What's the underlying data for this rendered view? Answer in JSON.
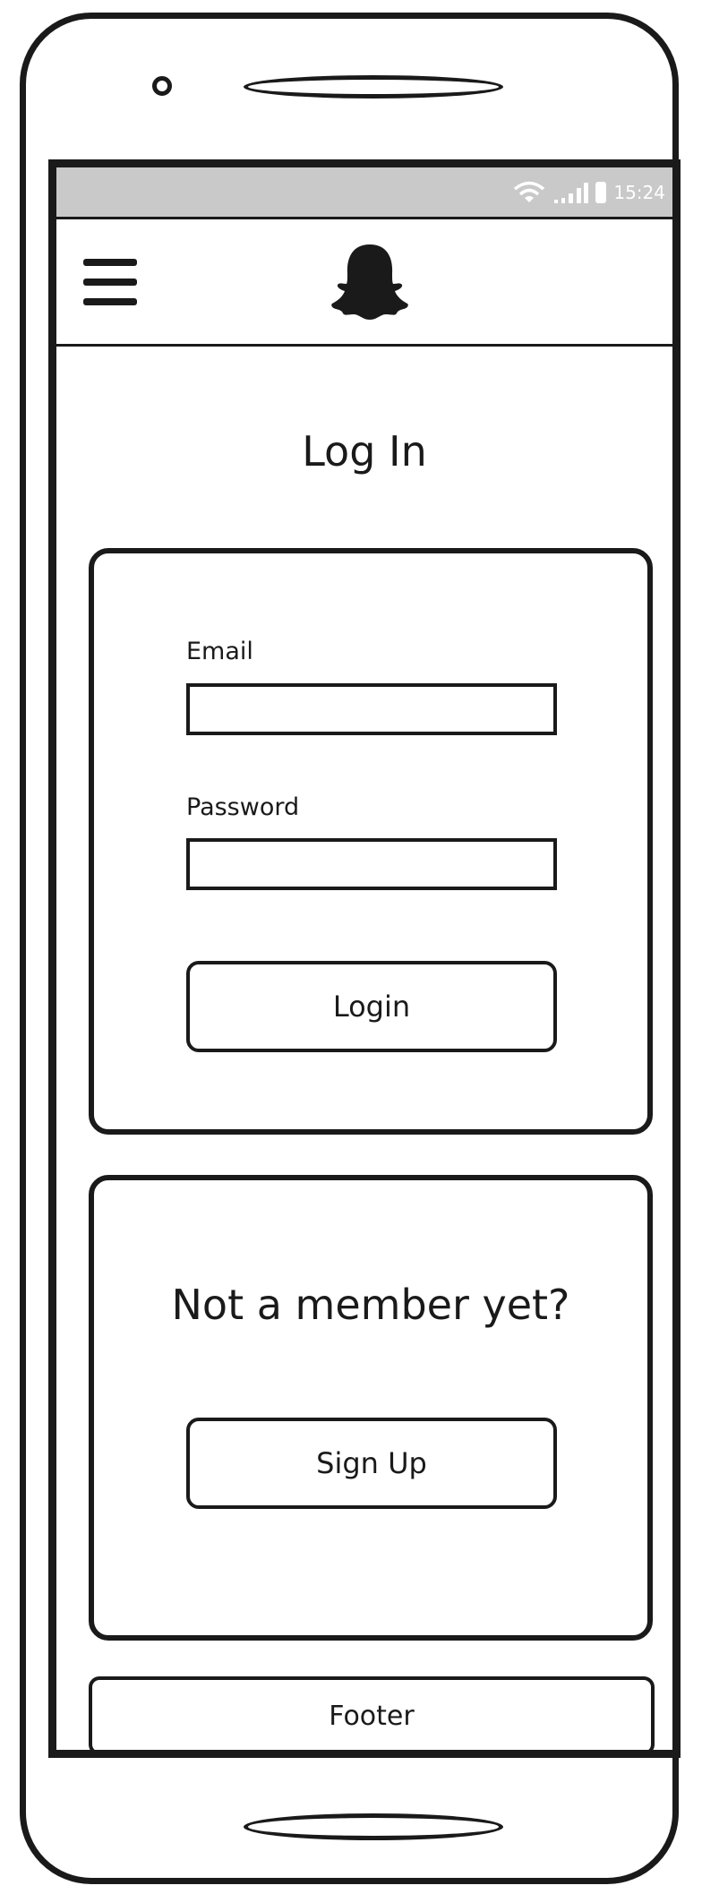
{
  "status_bar": {
    "time": "15:24"
  },
  "header": {
    "menu_icon": "hamburger-menu-icon",
    "logo_icon": "snapchat-ghost-icon"
  },
  "page": {
    "title": "Log In"
  },
  "login_form": {
    "email_label": "Email",
    "email_value": "",
    "password_label": "Password",
    "password_value": "",
    "login_button": "Login"
  },
  "signup": {
    "prompt": "Not a member yet?",
    "signup_button": "Sign Up"
  },
  "footer": {
    "label": "Footer"
  },
  "colors": {
    "ink": "#1a1a1a",
    "status_bar_bg": "#c9c9c9",
    "background": "#ffffff"
  }
}
